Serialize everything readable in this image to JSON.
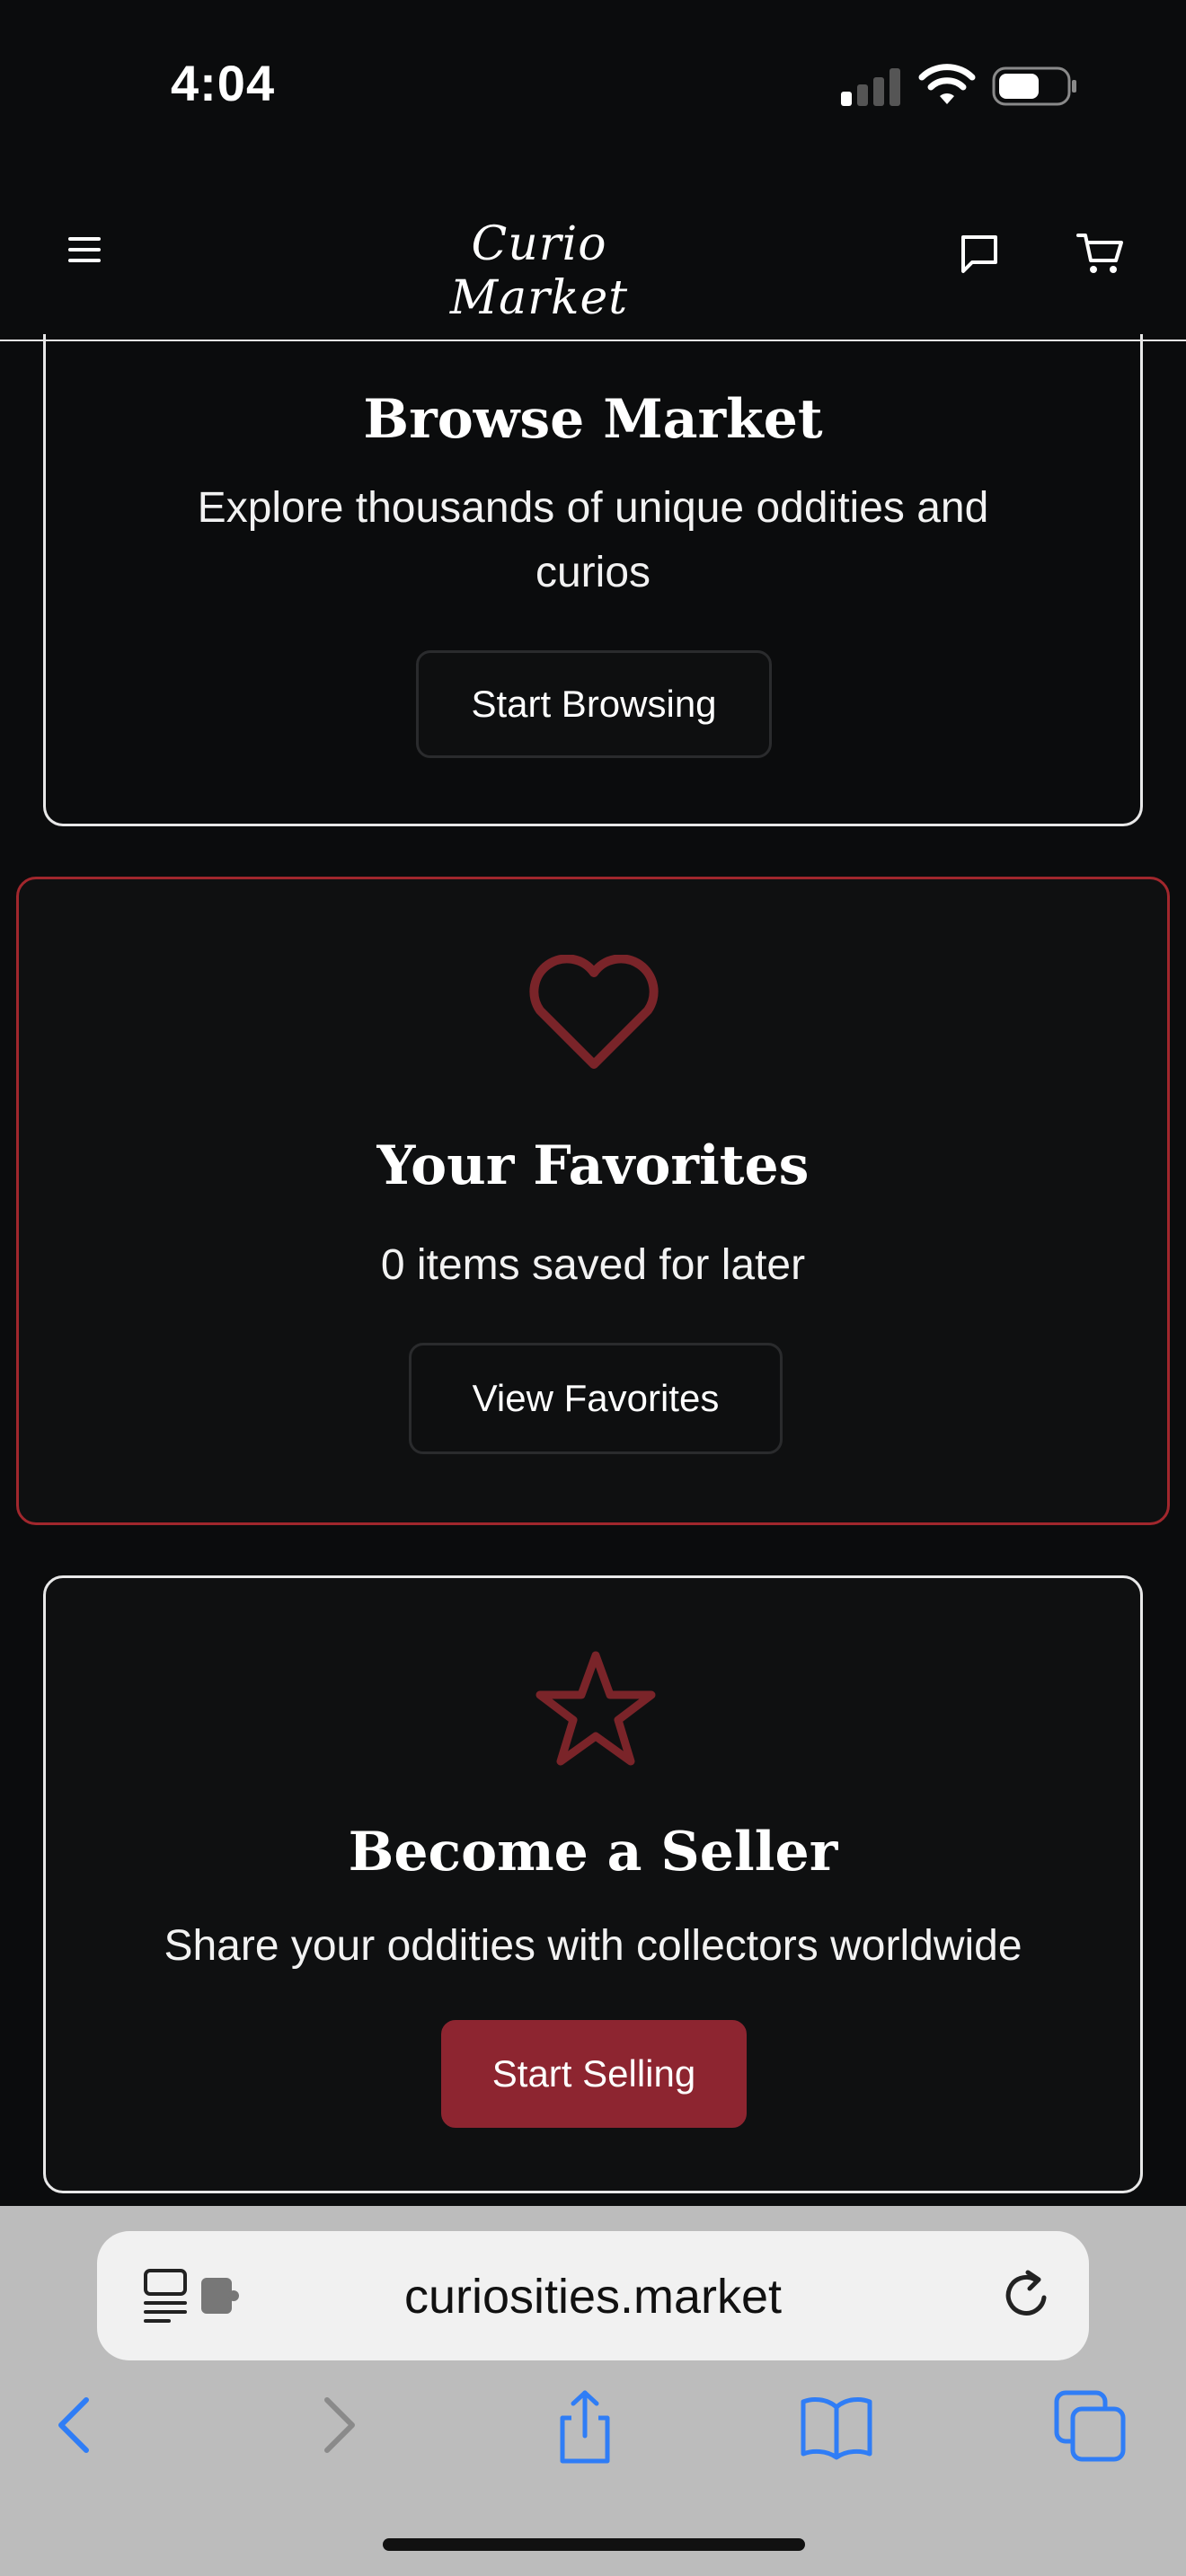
{
  "status_bar": {
    "time": "4:04",
    "signal_icon": "cellular-signal-icon",
    "wifi_icon": "wifi-icon",
    "battery_icon": "battery-icon"
  },
  "header": {
    "logo_text": "Curio Market",
    "menu_icon": "hamburger-menu-icon",
    "messages_icon": "chat-bubble-icon",
    "cart_icon": "shopping-cart-icon"
  },
  "cards": {
    "browse": {
      "title": "Browse Market",
      "description_line1": "Explore thousands of unique oddities and",
      "description_line2": "curios",
      "button_label": "Start Browsing"
    },
    "favorites": {
      "icon": "heart-icon",
      "title": "Your Favorites",
      "description": "0 items saved for later",
      "button_label": "View Favorites"
    },
    "seller": {
      "icon": "star-icon",
      "title": "Become a Seller",
      "description": "Share your oddities with collectors worldwide",
      "button_label": "Start Selling"
    }
  },
  "browser": {
    "url": "curiosities.market",
    "reader_icon": "page-menu-icon",
    "reload_icon": "reload-icon",
    "toolbar": [
      "back-icon",
      "forward-icon",
      "share-icon",
      "bookmarks-icon",
      "tabs-icon"
    ]
  },
  "colors": {
    "background": "#0b0c0d",
    "accent_red": "#8d2530",
    "favorites_border": "#a1272d",
    "icon_red": "#7a2429",
    "browser_blue": "#2f7df6"
  }
}
